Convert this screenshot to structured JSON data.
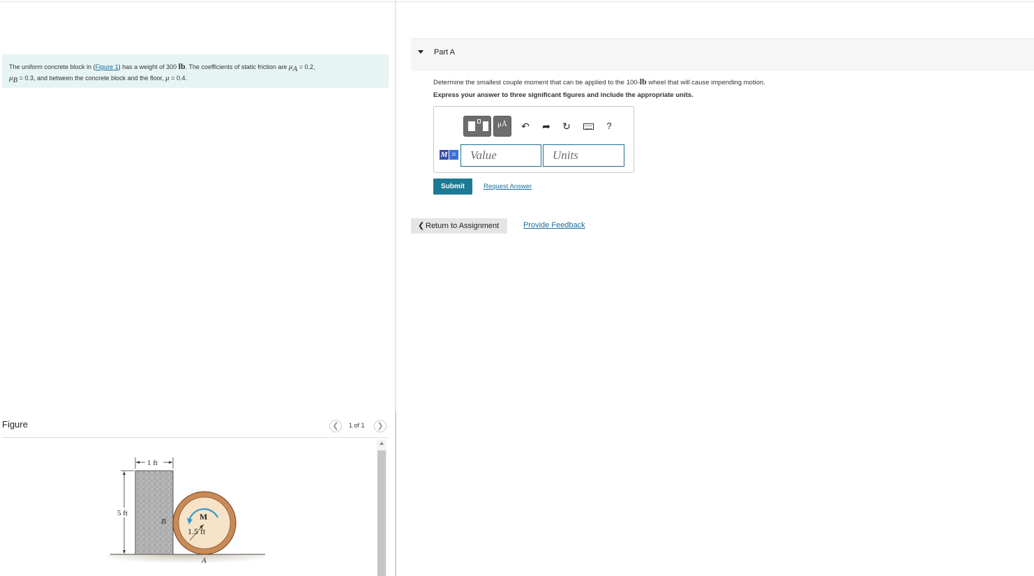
{
  "problem": {
    "intro": "The uniform concrete block in (",
    "figure_link": "Figure 1",
    "mid1": ") has a weight of 300 ",
    "weight_unit": "lb",
    "mid2": ". The coefficients of static friction are ",
    "mu_a_sym": "μ",
    "mu_a_sub": "A",
    "mu_a_val": " = 0.2,",
    "mu_b_sym": "μ",
    "mu_b_sub": "B",
    "mu_b_val": " = 0.3, and between the concrete block and the floor, ",
    "mu_sym": "μ",
    "mu_val": " = 0.4."
  },
  "figure": {
    "title": "Figure",
    "counter": "1 of 1",
    "prev_icon": "chevron-left-icon",
    "next_icon": "chevron-right-icon",
    "labels": {
      "width": "1 ft",
      "height": "5 ft",
      "point_b": "B",
      "moment": "M",
      "radius": "1.5 ft",
      "point_a": "A"
    }
  },
  "part": {
    "title": "Part A",
    "toggle_icon": "caret-down-icon",
    "question_pre": "Determine the smallest couple moment that can be applied to the 100-",
    "question_unit": "lb",
    "question_post": " wheel that will cause impending motion.",
    "instruction": "Express your answer to three significant figures and include the appropriate units."
  },
  "toolbar": {
    "templates_icon": "templates-icon",
    "units_label": "μÅ",
    "undo_icon": "undo-icon",
    "redo_icon": "redo-icon",
    "reset_icon": "reset-icon",
    "keyboard_icon": "keyboard-icon",
    "help_label": "?"
  },
  "answer": {
    "badge_m": "M",
    "badge_eq": "=",
    "value_placeholder": "Value",
    "units_placeholder": "Units"
  },
  "actions": {
    "submit_label": "Submit",
    "request_answer_label": "Request Answer",
    "return_label": "Return to Assignment",
    "feedback_label": "Provide Feedback"
  },
  "colors": {
    "accent": "#1d7a94",
    "link": "#1a6c9c",
    "problem_bg": "#e6f4f4"
  }
}
